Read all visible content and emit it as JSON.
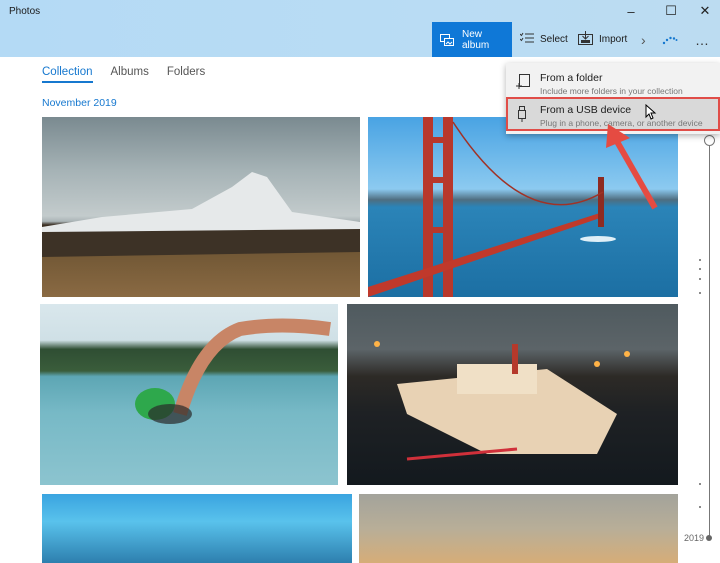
{
  "window": {
    "title": "Photos",
    "controls": {
      "minimize": "–",
      "maximize": "☐",
      "close": "✕"
    }
  },
  "toolbar": {
    "new_album_label": "New album",
    "select_label": "Select",
    "import_label": "Import",
    "more_chevron": "›",
    "more_options": "…",
    "accent_color": "#0f78d7"
  },
  "tabs": [
    {
      "label": "Collection",
      "active": true
    },
    {
      "label": "Albums",
      "active": false
    },
    {
      "label": "Folders",
      "active": false
    }
  ],
  "section": {
    "date_heading": "November 2019"
  },
  "photos": [
    {
      "name": "mountain-photo"
    },
    {
      "name": "golden-gate-bridge-photo"
    },
    {
      "name": "swimmer-photo"
    },
    {
      "name": "riverboat-photo"
    },
    {
      "name": "underwater-photo"
    },
    {
      "name": "sunset-photo"
    }
  ],
  "import_menu": {
    "items": [
      {
        "title": "From a folder",
        "subtitle": "Include more folders in your collection",
        "icon": "add-folder-icon"
      },
      {
        "title": "From a USB device",
        "subtitle": "Plug in a phone, camera, or another device",
        "icon": "usb-icon",
        "highlighted": true
      }
    ],
    "highlight_color": "#e04d48"
  },
  "timeline": {
    "year_label": "2019"
  }
}
